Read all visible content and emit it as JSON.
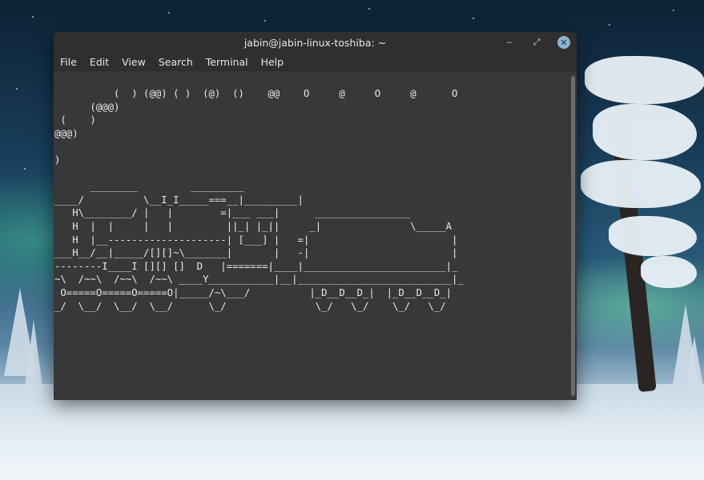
{
  "window": {
    "title": "jabin@jabin-linux-toshiba: ~",
    "minimize_glyph": "‒",
    "maximize_glyph": "⤢",
    "close_glyph": "✕"
  },
  "menu": {
    "items": [
      "File",
      "Edit",
      "View",
      "Search",
      "Terminal",
      "Help"
    ]
  },
  "terminal": {
    "lines": [
      "          (  ) (@@) ( )  (@)  ()    @@    O     @     O     @      O",
      "      (@@@)",
      " (    )",
      "@@@)",
      "",
      ")",
      "",
      "      ________         _________",
      "____/          \\__I_I_____===__|_________|",
      "   H\\________/ |   |        =|___ ___|      ________________",
      "   H  |  |     |   |         ||_| |_||     _|               \\_____A",
      "   H  |__--------------------| [___] |   =|                        |",
      "___H__/__|_____/[][]~\\_______|       |   -|                        |",
      "--------I____I [][] []  D   |=======|____|________________________|_",
      "~\\  /~~\\  /~~\\  /~~\\ ____Y___________|__|__________________________|_",
      " O=====O=====O=====O|_____/~\\___/          |_D__D__D_|  |_D__D__D_|",
      "_/  \\__/  \\__/  \\__/      \\_/               \\_/   \\_/    \\_/   \\_/"
    ]
  },
  "icons": {
    "minimize": "minimize-icon",
    "maximize": "maximize-icon",
    "close": "close-icon"
  },
  "colors": {
    "terminal_bg": "#383838",
    "titlebar_bg": "#2f2f2f",
    "text": "#e9e9e9",
    "close_accent": "#8ab4d6"
  }
}
